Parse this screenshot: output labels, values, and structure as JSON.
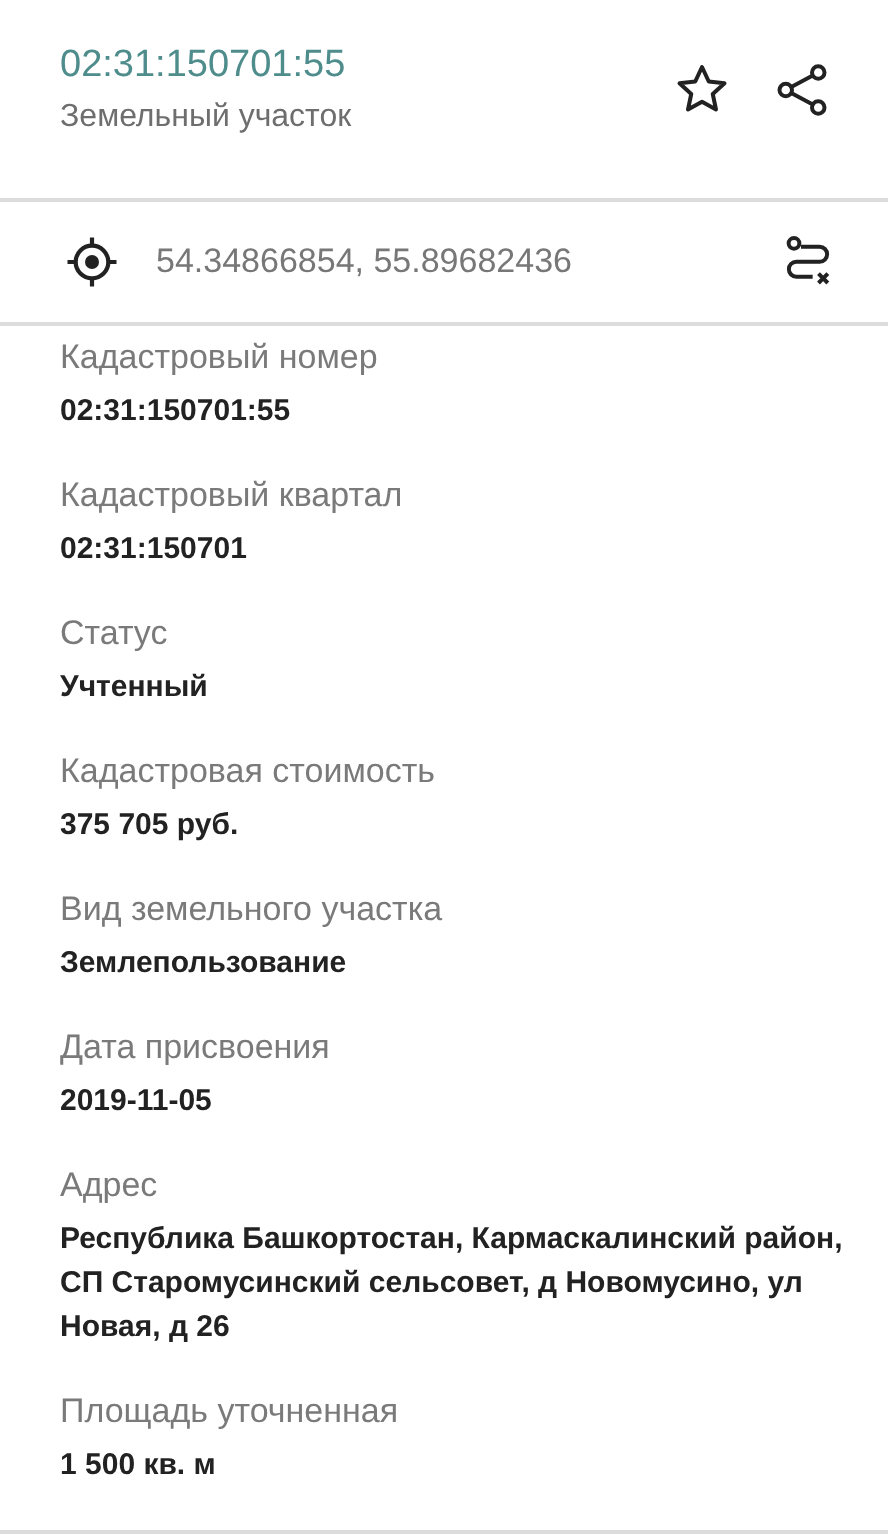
{
  "header": {
    "title": "02:31:150701:55",
    "subtitle": "Земельный участок",
    "favorite": false
  },
  "coordinates": "54.34866854, 55.89682436",
  "fields": [
    {
      "label": "Кадастровый номер",
      "value": "02:31:150701:55"
    },
    {
      "label": "Кадастровый квартал",
      "value": "02:31:150701"
    },
    {
      "label": "Статус",
      "value": "Учтенный"
    },
    {
      "label": "Кадастровая стоимость",
      "value": "375 705 руб."
    },
    {
      "label": "Вид земельного участка",
      "value": "Землепользование"
    },
    {
      "label": "Дата присвоения",
      "value": "2019-11-05"
    },
    {
      "label": "Адрес",
      "value": "Республика Башкортостан, Кармаскалинский район, СП Старомусинский сельсовет, д Новомусино, ул Новая, д 26"
    },
    {
      "label": "Площадь уточненная",
      "value": "1 500 кв. м"
    }
  ]
}
